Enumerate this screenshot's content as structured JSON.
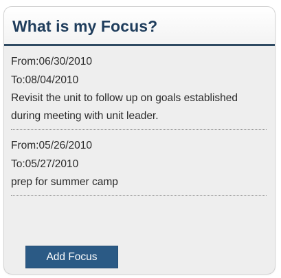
{
  "panel": {
    "title": "What is my Focus?"
  },
  "entries": [
    {
      "from": "From:06/30/2010",
      "to": "To:08/04/2010",
      "description": "Revisit the unit to follow up on goals established during meeting with unit leader."
    },
    {
      "from": "From:05/26/2010",
      "to": "To:05/27/2010",
      "description": "prep for summer camp"
    }
  ],
  "actions": {
    "add_focus_label": "Add Focus"
  },
  "colors": {
    "title": "#1f3d5c",
    "header_rule": "#2f4a62",
    "button_bg": "#2b5a85",
    "panel_bg": "#eeeeee"
  }
}
